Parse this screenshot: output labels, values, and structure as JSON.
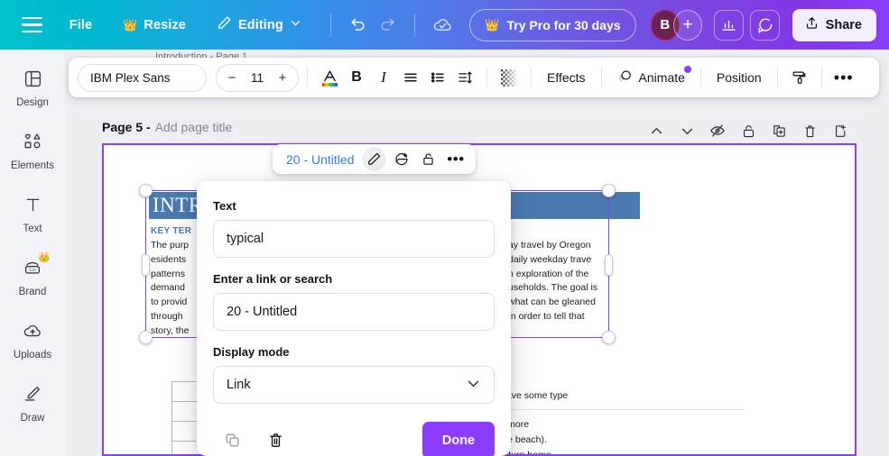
{
  "topbar": {
    "menu_icon": "hamburger-icon",
    "file": "File",
    "resize": "Resize",
    "editing": "Editing",
    "undo_icon": "undo-icon",
    "redo_icon": "redo-icon",
    "cloud_icon": "cloud-sync-icon",
    "try_pro": "Try Pro for 30 days",
    "avatar_initial": "B",
    "plus": "+",
    "insights_icon": "bar-chart-icon",
    "comment_icon": "comment-icon",
    "share": "Share",
    "gradient_start": "#00c2cb",
    "gradient_end": "#8b3dff"
  },
  "sidebar": {
    "items": [
      {
        "label": "Design",
        "icon": "design-icon",
        "pro": false
      },
      {
        "label": "Elements",
        "icon": "elements-icon",
        "pro": false
      },
      {
        "label": "Text",
        "icon": "text-icon",
        "pro": false
      },
      {
        "label": "Brand",
        "icon": "brand-icon",
        "pro": true
      },
      {
        "label": "Uploads",
        "icon": "uploads-icon",
        "pro": false
      },
      {
        "label": "Draw",
        "icon": "draw-icon",
        "pro": false
      }
    ]
  },
  "format_toolbar": {
    "font_family": "IBM Plex Sans",
    "font_size": "11",
    "decrease": "−",
    "increase": "+",
    "text_color_icon": "text-color-icon",
    "bold": "B",
    "italic": "I",
    "align_icon": "align-icon",
    "list_icon": "bullet-list-icon",
    "spacing_icon": "line-spacing-icon",
    "transparency_icon": "transparency-icon",
    "effects": "Effects",
    "animate": "Animate",
    "position": "Position",
    "paint_icon": "paint-roller-icon",
    "more": "•••"
  },
  "page_header": {
    "page_number": "Page 5 -",
    "page_title_placeholder": "Add page title",
    "tools": [
      "collapse-up-icon",
      "expand-down-icon",
      "hide-page-icon",
      "lock-icon",
      "duplicate-icon",
      "delete-icon",
      "add-page-icon"
    ],
    "obscured_tab_label": "Introduction - Page 1"
  },
  "element_toolbar": {
    "link_label": "20 - Untitled",
    "edit_icon": "pencil-icon",
    "comment_icon": "add-comment-icon",
    "lock_icon": "unlock-icon",
    "more_icon": "more-horizontal-icon"
  },
  "link_dialog": {
    "text_label": "Text",
    "text_value": "typical",
    "link_label": "Enter a link or search",
    "link_value": "20 - Untitled",
    "display_mode_label": "Display mode",
    "display_mode_value": "Link",
    "copy_icon": "copy-icon",
    "delete_icon": "trash-icon",
    "done_label": "Done",
    "accent_color": "#8b3dff"
  },
  "document": {
    "banner_text": "INTR",
    "banner_color": "#4a7ab0",
    "key_term": "KEY TER",
    "body_left": [
      "The  purp",
      "esidents",
      "patterns",
      "demand",
      "to provid",
      "through",
      "story, the"
    ],
    "body_right": [
      "ay  travel  by  Oregon",
      "daily  weekday  trave",
      "n  exploration  of  the",
      "useholds.  The  goal  is",
      "what  can  be  gleaned",
      "In  order  to  tell  that"
    ],
    "lower_text": [
      "e meals and have some type",
      "ing out one or more",
      "om home to the beach).",
      "e traveler(s) return home"
    ]
  }
}
